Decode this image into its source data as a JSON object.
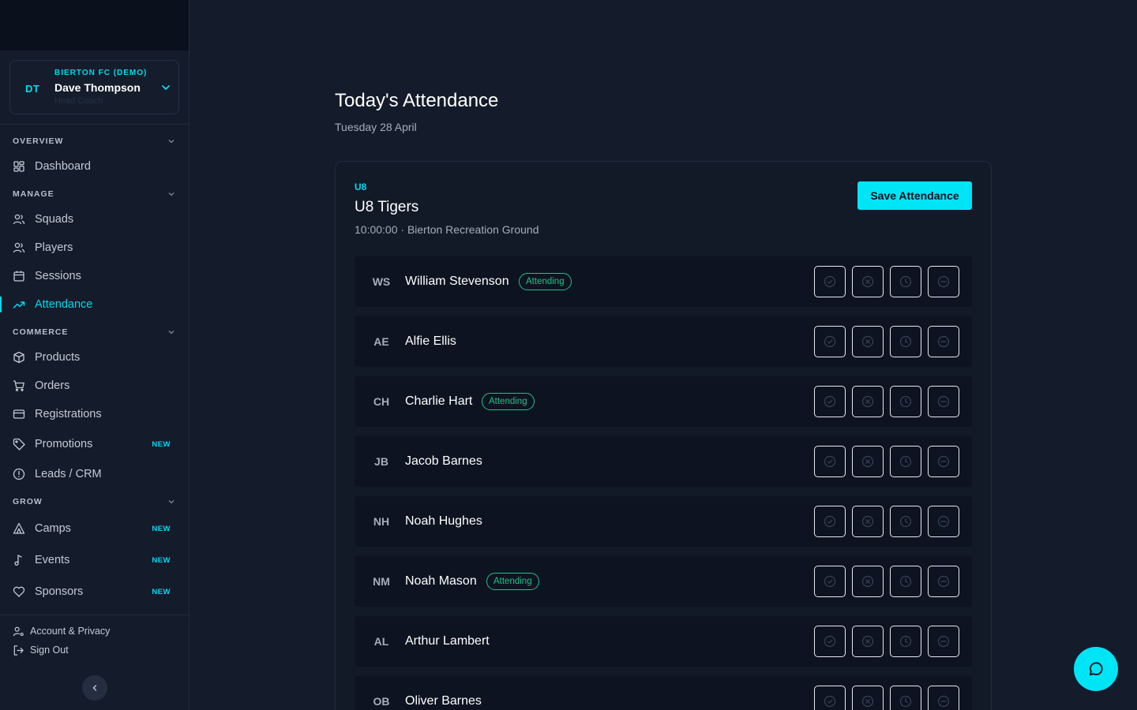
{
  "user": {
    "initials": "DT",
    "club": "BIERTON FC (DEMO)",
    "name": "Dave Thompson",
    "role": "Head Coach"
  },
  "sidebar": {
    "sections": [
      {
        "title": "OVERVIEW",
        "items": [
          {
            "label": "Dashboard",
            "icon": "grid-icon"
          }
        ]
      },
      {
        "title": "MANAGE",
        "items": [
          {
            "label": "Squads",
            "icon": "users-icon"
          },
          {
            "label": "Players",
            "icon": "users-icon"
          },
          {
            "label": "Sessions",
            "icon": "calendar-icon"
          },
          {
            "label": "Attendance",
            "icon": "trend-icon",
            "active": true
          }
        ]
      },
      {
        "title": "COMMERCE",
        "items": [
          {
            "label": "Products",
            "icon": "box-icon"
          },
          {
            "label": "Orders",
            "icon": "cart-icon"
          },
          {
            "label": "Registrations",
            "icon": "card-icon"
          },
          {
            "label": "Promotions",
            "icon": "tag-icon",
            "badge": "NEW"
          },
          {
            "label": "Leads / CRM",
            "icon": "alert-circle-icon"
          }
        ]
      },
      {
        "title": "GROW",
        "items": [
          {
            "label": "Camps",
            "icon": "tent-icon",
            "badge": "NEW"
          },
          {
            "label": "Events",
            "icon": "music-icon",
            "badge": "NEW"
          },
          {
            "label": "Sponsors",
            "icon": "heart-icon",
            "badge": "NEW"
          }
        ]
      }
    ],
    "footer": {
      "account": "Account & Privacy",
      "signout": "Sign Out"
    }
  },
  "main": {
    "title": "Today's Attendance",
    "date": "Tuesday 28 April",
    "squad": {
      "tag": "U8",
      "name": "U8 Tigers",
      "meta": "10:00:00 · Bierton Recreation Ground",
      "save_label": "Save Attendance"
    },
    "players": [
      {
        "initials": "WS",
        "name": "William Stevenson",
        "status": "Attending"
      },
      {
        "initials": "AE",
        "name": "Alfie Ellis",
        "status": ""
      },
      {
        "initials": "CH",
        "name": "Charlie Hart",
        "status": "Attending"
      },
      {
        "initials": "JB",
        "name": "Jacob Barnes",
        "status": ""
      },
      {
        "initials": "NH",
        "name": "Noah Hughes",
        "status": ""
      },
      {
        "initials": "NM",
        "name": "Noah Mason",
        "status": "Attending"
      },
      {
        "initials": "AL",
        "name": "Arthur Lambert",
        "status": ""
      },
      {
        "initials": "OB",
        "name": "Oliver Barnes",
        "status": ""
      }
    ]
  },
  "colors": {
    "accent": "#00e5f5",
    "attending": "#20c38a",
    "background": "#141c2b"
  }
}
